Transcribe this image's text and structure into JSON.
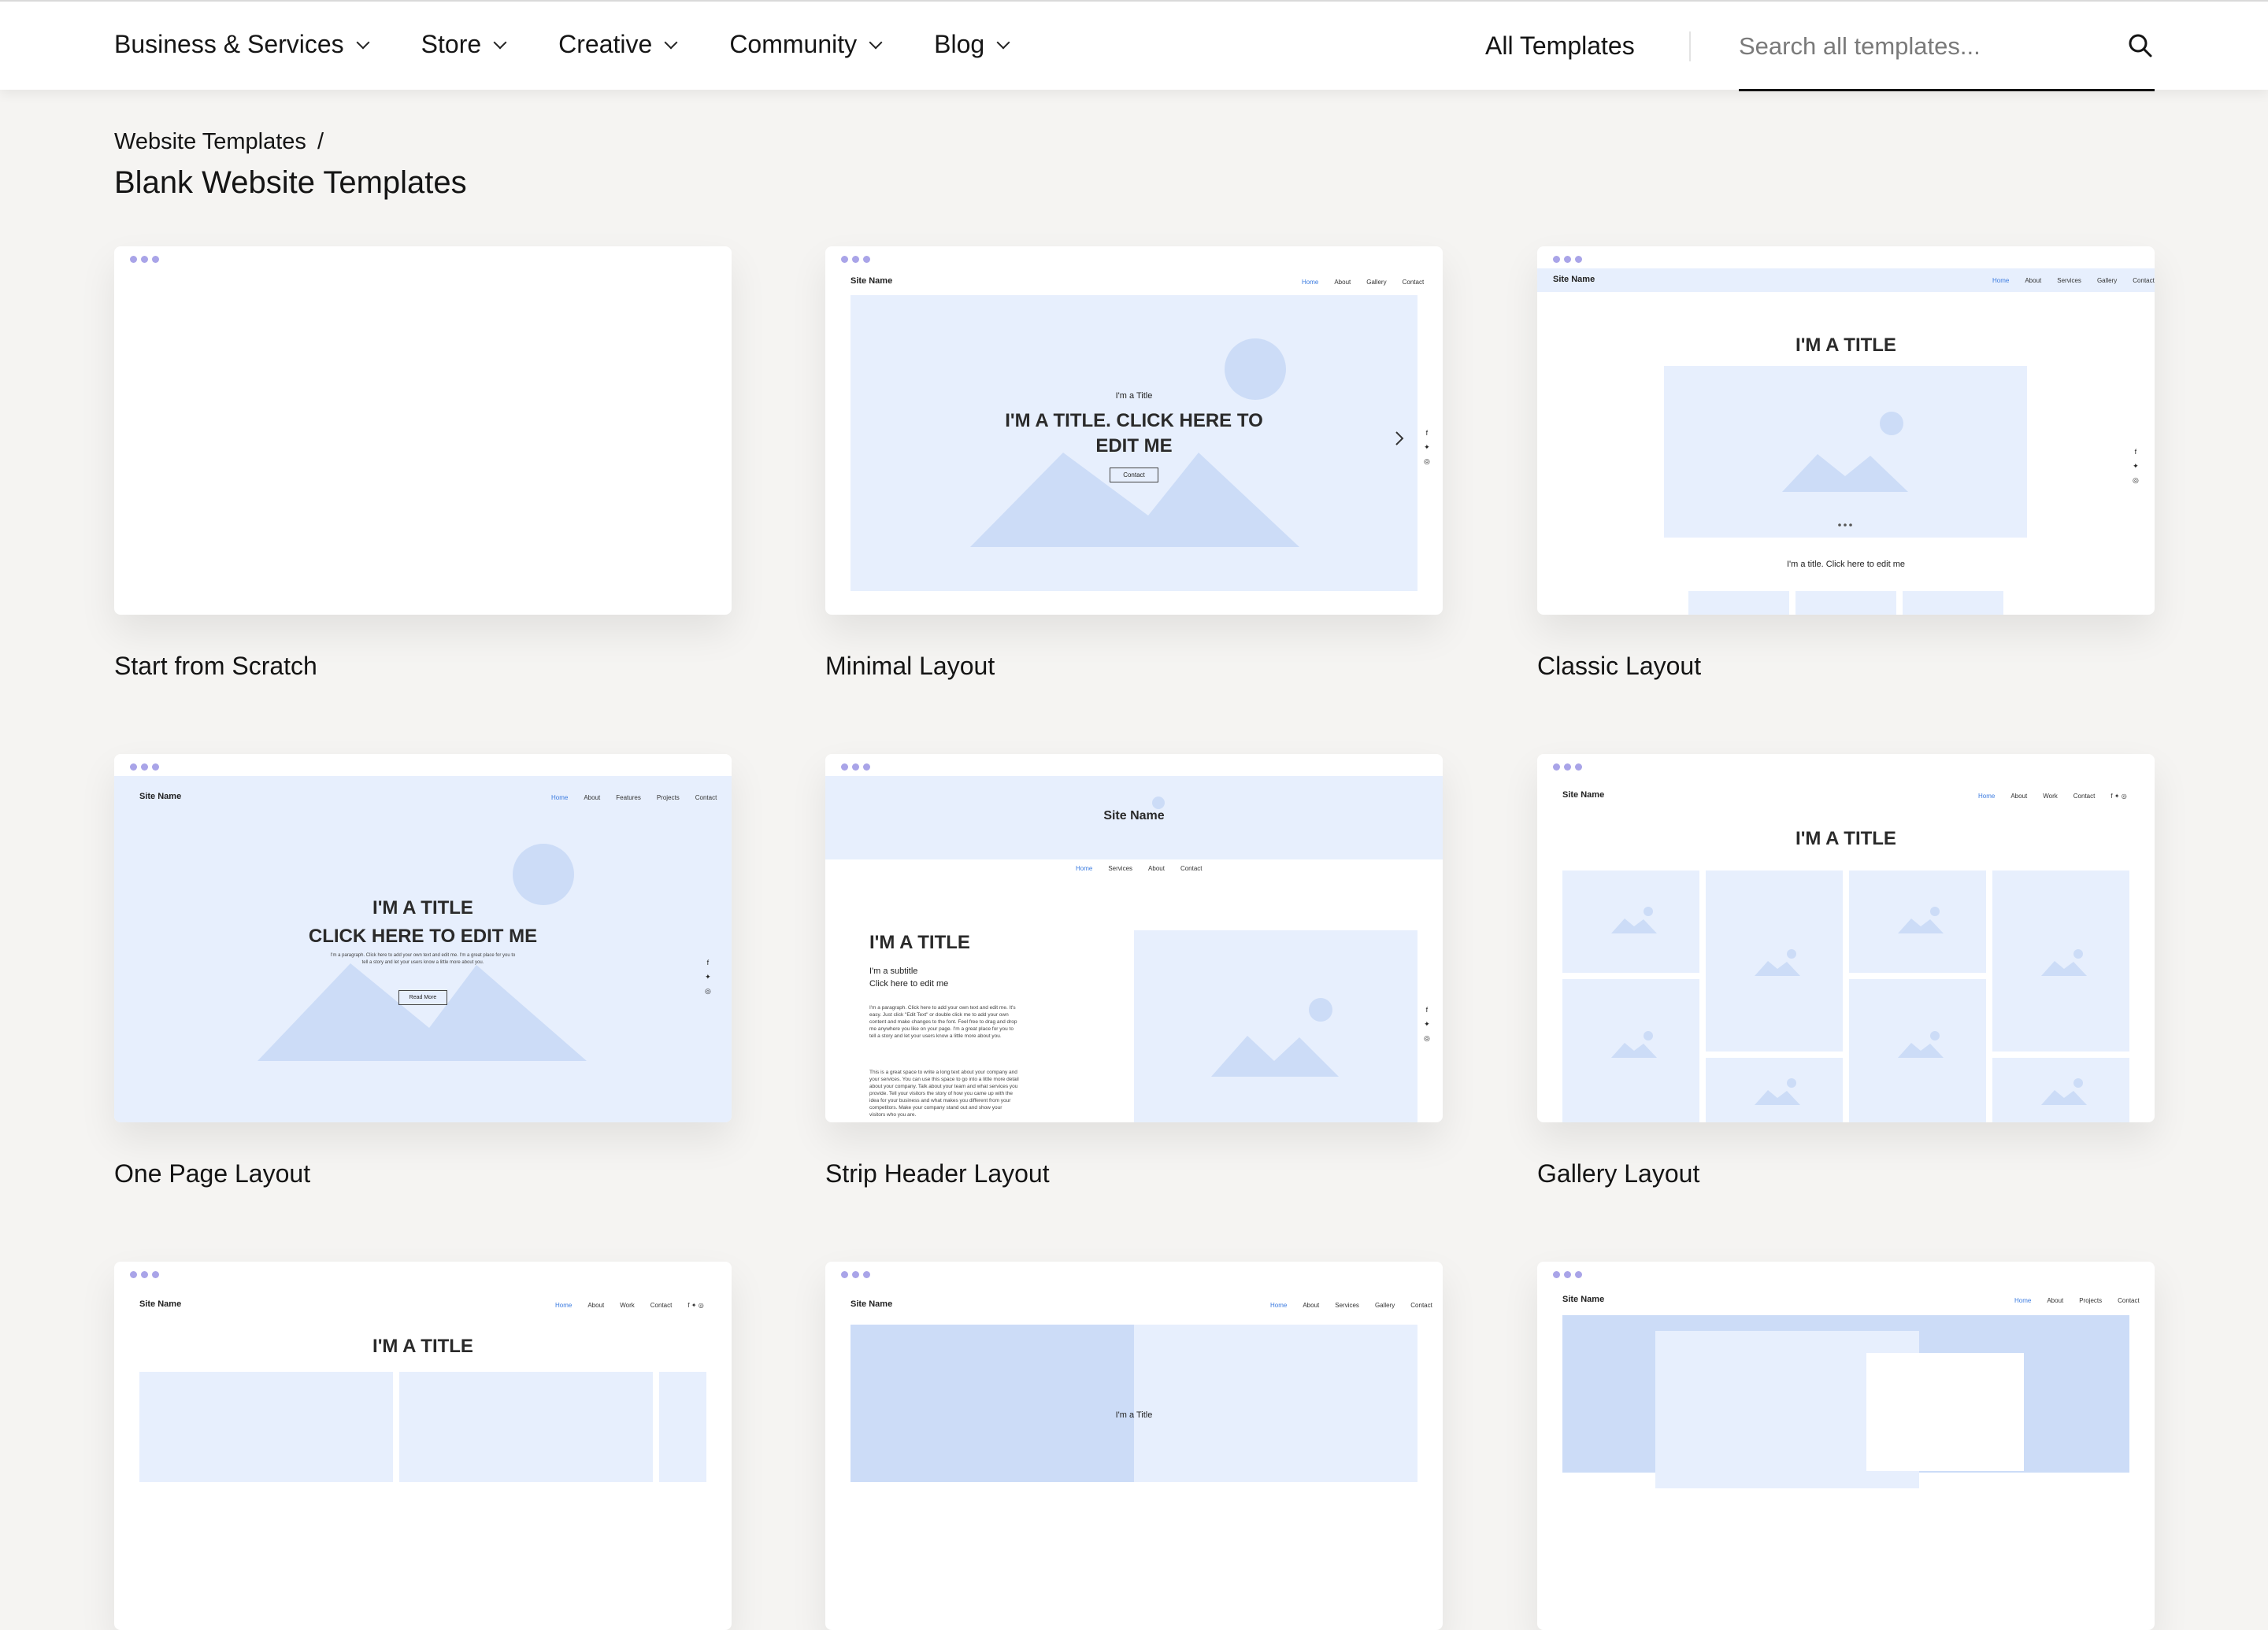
{
  "nav": {
    "items": [
      "Business & Services",
      "Store",
      "Creative",
      "Community",
      "Blog"
    ],
    "all_templates": "All Templates",
    "search_placeholder": "Search all templates..."
  },
  "breadcrumb": {
    "parent": "Website Templates",
    "separator": "/"
  },
  "page_title": "Blank Website Templates",
  "cards": [
    {
      "label": "Start from Scratch"
    },
    {
      "label": "Minimal Layout",
      "preview": {
        "site": "Site Name",
        "links": [
          "Home",
          "About",
          "Gallery",
          "Contact"
        ],
        "kicker": "I'm a Title",
        "title": "I'M A TITLE. CLICK HERE TO EDIT ME",
        "button": "Contact"
      }
    },
    {
      "label": "Classic Layout",
      "preview": {
        "site": "Site Name",
        "links": [
          "Home",
          "About",
          "Services",
          "Gallery",
          "Contact"
        ],
        "title": "I'M A TITLE",
        "caption": "I'm a title. Click here to edit me"
      }
    },
    {
      "label": "One Page Layout",
      "preview": {
        "site": "Site Name",
        "links": [
          "Home",
          "About",
          "Features",
          "Projects",
          "Contact"
        ],
        "title1": "I'M A TITLE",
        "title2": "CLICK HERE TO EDIT ME",
        "para": "I'm a paragraph. Click here to add your own text and edit me. I'm a great place for you to tell a story and let your users know a little more about you.",
        "button": "Read More"
      }
    },
    {
      "label": "Strip Header Layout",
      "preview": {
        "site": "Site Name",
        "links": [
          "Home",
          "Services",
          "About",
          "Contact"
        ],
        "title": "I'M A TITLE",
        "sub1": "I'm a subtitle",
        "sub2": "Click here to edit me",
        "para1": "I'm a paragraph. Click here to add your own text and edit me. It's easy. Just click \"Edit Text\" or double click me to add your own content and make changes to the font. Feel free to drag and drop me anywhere you like on your page. I'm a great place for you to tell a story and let your users know a little more about you.",
        "para2": "This is a great space to write a long text about your company and your services. You can use this space to go into a little more detail about your company. Talk about your team and what services you provide. Tell your visitors the story of how you came up with the idea for your business and what makes you different from your competitors. Make your company stand out and show your visitors who you are."
      }
    },
    {
      "label": "Gallery Layout",
      "preview": {
        "site": "Site Name",
        "links": [
          "Home",
          "About",
          "Work",
          "Contact"
        ],
        "title": "I'M A TITLE"
      }
    },
    {
      "label": "",
      "preview": {
        "site": "Site Name",
        "links": [
          "Home",
          "About",
          "Work",
          "Contact"
        ],
        "title": "I'M A TITLE"
      }
    },
    {
      "label": "",
      "preview": {
        "site": "Site Name",
        "links": [
          "Home",
          "About",
          "Services",
          "Gallery",
          "Contact"
        ],
        "kicker": "I'm a Title"
      }
    },
    {
      "label": "",
      "preview": {
        "site": "Site Name",
        "links": [
          "Home",
          "About",
          "Projects",
          "Contact"
        ]
      }
    }
  ],
  "colors": {
    "accent_link": "#3b7be0",
    "preview_blue": "#e7effd",
    "preview_blue_dark": "#ccdcf7",
    "dots": "#a9a4e8"
  }
}
